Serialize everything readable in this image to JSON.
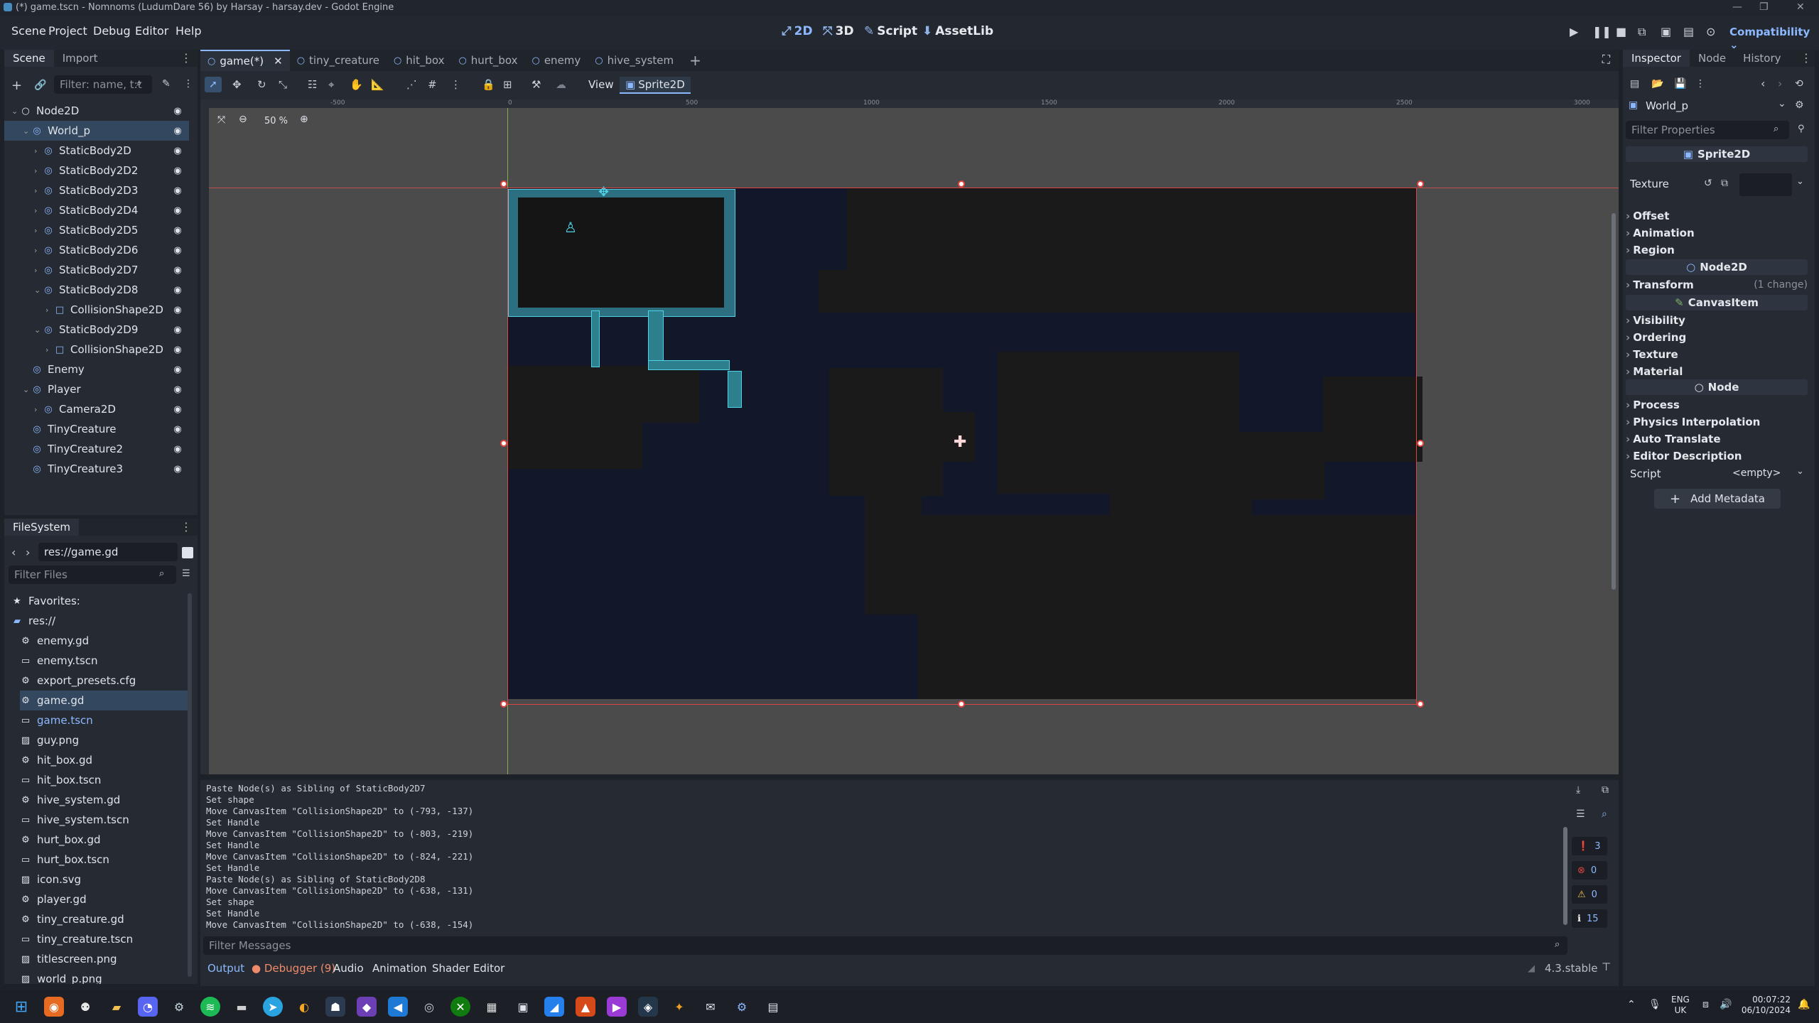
{
  "window": {
    "title": "(*) game.tscn - Nomnoms (LudumDare 56) by Harsay - harsay.dev - Godot Engine"
  },
  "menu": [
    "Scene",
    "Project",
    "Debug",
    "Editor",
    "Help"
  ],
  "workspaces": [
    {
      "label": "2D",
      "icon": "2d-icon"
    },
    {
      "label": "3D",
      "icon": "3d-icon"
    },
    {
      "label": "Script",
      "icon": "script-icon"
    },
    {
      "label": "AssetLib",
      "icon": "assetlib-icon"
    }
  ],
  "renderer": "Compatibility",
  "scene_dock": {
    "tabs": [
      "Scene",
      "Import"
    ],
    "filter_placeholder": "Filter: name, t:t",
    "tree": [
      {
        "label": "Node2D",
        "icon": "node2d-icon",
        "depth": 0
      },
      {
        "label": "World_p",
        "icon": "sprite-icon",
        "depth": 1,
        "selected": true
      },
      {
        "label": "StaticBody2D",
        "depth": 2
      },
      {
        "label": "StaticBody2D2",
        "depth": 2
      },
      {
        "label": "StaticBody2D3",
        "depth": 2
      },
      {
        "label": "StaticBody2D4",
        "depth": 2
      },
      {
        "label": "StaticBody2D5",
        "depth": 2
      },
      {
        "label": "StaticBody2D6",
        "depth": 2
      },
      {
        "label": "StaticBody2D7",
        "depth": 2
      },
      {
        "label": "StaticBody2D8",
        "depth": 2
      },
      {
        "label": "CollisionShape2D",
        "depth": 3
      },
      {
        "label": "StaticBody2D9",
        "depth": 2
      },
      {
        "label": "CollisionShape2D",
        "depth": 3
      },
      {
        "label": "Enemy",
        "depth": 1
      },
      {
        "label": "Player",
        "depth": 1
      },
      {
        "label": "Camera2D",
        "depth": 2
      },
      {
        "label": "TinyCreature",
        "depth": 1
      },
      {
        "label": "TinyCreature2",
        "depth": 1
      },
      {
        "label": "TinyCreature3",
        "depth": 1
      }
    ]
  },
  "filesystem": {
    "tab": "FileSystem",
    "path": "res://game.gd",
    "filter_placeholder": "Filter Files",
    "items": [
      {
        "label": "Favorites:",
        "icon": "star-icon"
      },
      {
        "label": "res://",
        "icon": "folder-icon"
      },
      {
        "label": "enemy.gd",
        "icon": "gear-icon"
      },
      {
        "label": "enemy.tscn",
        "icon": "scene-icon"
      },
      {
        "label": "export_presets.cfg",
        "icon": "gear-icon"
      },
      {
        "label": "game.gd",
        "icon": "gear-icon",
        "selected": true
      },
      {
        "label": "game.tscn",
        "icon": "scene-icon",
        "accent": true
      },
      {
        "label": "guy.png",
        "icon": "image-icon"
      },
      {
        "label": "hit_box.gd",
        "icon": "gear-icon"
      },
      {
        "label": "hit_box.tscn",
        "icon": "scene-icon"
      },
      {
        "label": "hive_system.gd",
        "icon": "gear-icon"
      },
      {
        "label": "hive_system.tscn",
        "icon": "scene-icon"
      },
      {
        "label": "hurt_box.gd",
        "icon": "gear-icon"
      },
      {
        "label": "hurt_box.tscn",
        "icon": "scene-icon"
      },
      {
        "label": "icon.svg",
        "icon": "image-icon"
      },
      {
        "label": "player.gd",
        "icon": "gear-icon"
      },
      {
        "label": "tiny_creature.gd",
        "icon": "gear-icon"
      },
      {
        "label": "tiny_creature.tscn",
        "icon": "scene-icon"
      },
      {
        "label": "titlescreen.png",
        "icon": "image-icon"
      },
      {
        "label": "world_p.png",
        "icon": "image-icon"
      }
    ]
  },
  "scene_tabs": [
    "game(*)",
    "tiny_creature",
    "hit_box",
    "hurt_box",
    "enemy",
    "hive_system"
  ],
  "toolbar": {
    "view": "View",
    "sprite": "Sprite2D",
    "zoom": "50 %"
  },
  "ruler": [
    "-500",
    "0",
    "500",
    "1000",
    "1500",
    "2000",
    "2500",
    "3000"
  ],
  "inspector": {
    "tabs": [
      "Inspector",
      "Node",
      "History"
    ],
    "node": "World_p",
    "filter_placeholder": "Filter Properties",
    "class_header": "Sprite2D",
    "texture_label": "Texture",
    "sprite_props": [
      "Offset",
      "Animation",
      "Region"
    ],
    "node2d_header": "Node2D",
    "transform": "Transform",
    "transform_note": "(1 change)",
    "canvas_header": "CanvasItem",
    "canvas_props": [
      "Visibility",
      "Ordering",
      "Texture",
      "Material"
    ],
    "node_header": "Node",
    "node_props": [
      "Process",
      "Physics Interpolation",
      "Auto Translate",
      "Editor Description"
    ],
    "script_label": "Script",
    "script_value": "<empty>",
    "add_metadata": "Add Metadata"
  },
  "output": {
    "lines": [
      "Paste Node(s) as Sibling of StaticBody2D7",
      "Set shape",
      "Move CanvasItem \"CollisionShape2D\" to (-793, -137)",
      "Set Handle",
      "Move CanvasItem \"CollisionShape2D\" to (-803, -219)",
      "Set Handle",
      "Move CanvasItem \"CollisionShape2D\" to (-824, -221)",
      "Set Handle",
      "Paste Node(s) as Sibling of StaticBody2D8",
      "Move CanvasItem \"CollisionShape2D\" to (-638, -131)",
      "Set shape",
      "Set Handle",
      "Move CanvasItem \"CollisionShape2D\" to (-638, -154)"
    ],
    "filter_placeholder": "Filter Messages",
    "counts": {
      "messages": "3",
      "errors": "0",
      "warnings": "0",
      "info": "15"
    }
  },
  "bottom_tabs": [
    "Output",
    "Debugger (9)",
    "Audio",
    "Animation",
    "Shader Editor"
  ],
  "version": "4.3.stable",
  "tray": {
    "lang1": "ENG",
    "lang2": "UK",
    "time": "00:07:22",
    "date": "06/10/2024"
  },
  "colors": {
    "accent": "#8cb8ff",
    "selection": "#33475e",
    "error": "#e0443e",
    "warning": "#f2c04f"
  }
}
